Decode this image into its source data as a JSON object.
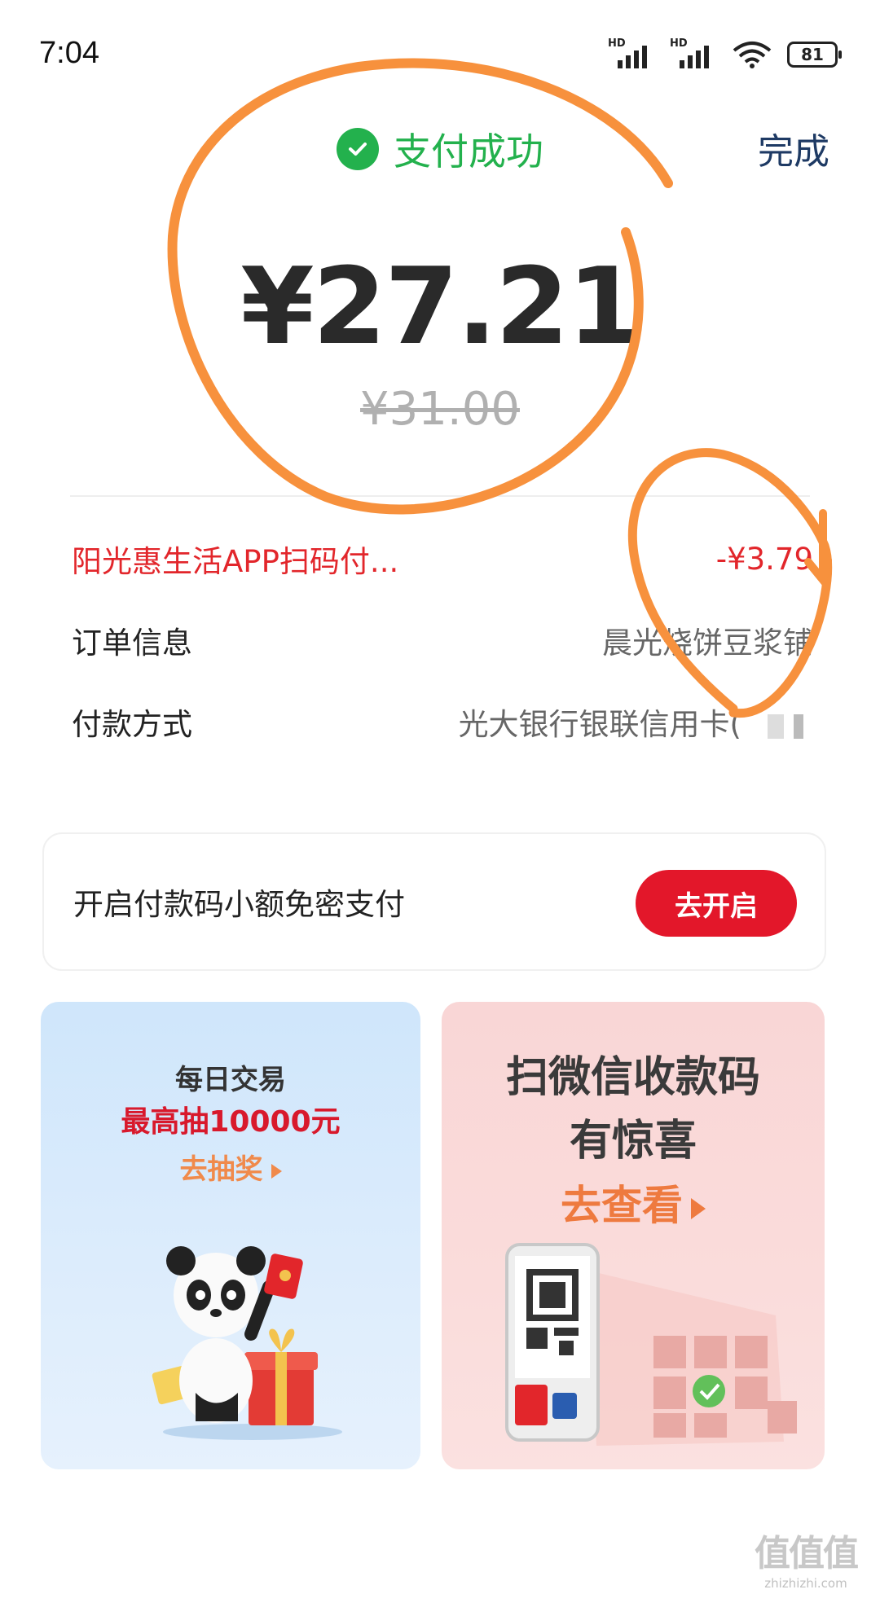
{
  "status_bar": {
    "time": "7:04",
    "sim1": "HD",
    "sim2": "HD",
    "battery": "81"
  },
  "header": {
    "status_text": "支付成功",
    "done_label": "完成"
  },
  "payment": {
    "amount": "¥27.21",
    "original_amount": "¥31.00"
  },
  "details": [
    {
      "label": "阳光惠生活APP扫码付...",
      "value": "-¥3.79",
      "highlight": true
    },
    {
      "label": "订单信息",
      "value": "晨光烧饼豆浆铺"
    },
    {
      "label": "付款方式",
      "value": "光大银行银联信用卡("
    }
  ],
  "smallpay": {
    "text": "开启付款码小额免密支付",
    "button_label": "去开启"
  },
  "promo_left": {
    "line1": "每日交易",
    "line2": "最高抽10000元",
    "cta": "去抽奖"
  },
  "promo_right": {
    "line1": "扫微信收款码",
    "line2": "有惊喜",
    "cta": "去查看"
  },
  "watermark": {
    "logo": "值值值",
    "url": "zhizhizhi.com"
  },
  "colors": {
    "success_green": "#23b14d",
    "brand_red": "#e3172a",
    "annotation_orange": "#f7913d",
    "done_navy": "#1e3a64"
  }
}
